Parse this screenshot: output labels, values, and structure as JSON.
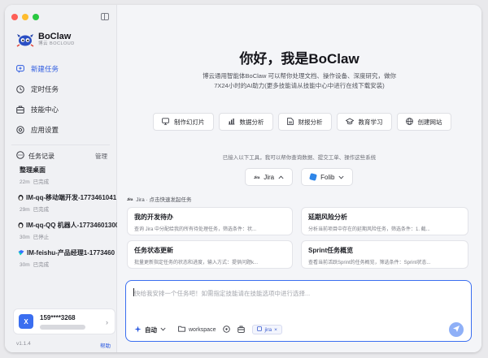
{
  "sidebar": {
    "brand": {
      "name": "BoClaw",
      "subtitle": "博云 BOCLOUD"
    },
    "nav": [
      {
        "label": "新建任务",
        "icon": "chat-plus-icon",
        "active": true
      },
      {
        "label": "定时任务",
        "icon": "clock-icon",
        "active": false
      },
      {
        "label": "技能中心",
        "icon": "skills-icon",
        "active": false
      },
      {
        "label": "应用设置",
        "icon": "gear-icon",
        "active": false
      }
    ],
    "history_title": "任务记录",
    "manage_label": "管理",
    "history": [
      {
        "title": "整理桌面",
        "time": "22m",
        "status": "已完成",
        "icon": ""
      },
      {
        "title": "IM-qq-移动端开发-1773461041",
        "time": "29m",
        "status": "已完成",
        "icon": "penguin-icon"
      },
      {
        "title": "IM-qq-QQ 机器人-17734601300",
        "time": "30m",
        "status": "已停止",
        "icon": "penguin-icon"
      },
      {
        "title": "IM-feishu-产品经理1-1773460",
        "time": "30m",
        "status": "已完成",
        "icon": "feishu-icon"
      }
    ],
    "user": {
      "phone": "159****3268",
      "avatar_letter": "X"
    },
    "version": "v1.1.4",
    "help_label": "帮助"
  },
  "main": {
    "greeting": "你好，我是BoClaw",
    "intro_line1": "博云通用智能体BoClaw 可以帮你处理文档、操作设备、深度研究，做你",
    "intro_line2": "7X24小时的AI助力(更多技能请从技能中心中进行在线下载安装)",
    "quick_actions": [
      {
        "label": "制作幻灯片",
        "icon": "slides-icon"
      },
      {
        "label": "数据分析",
        "icon": "chart-icon"
      },
      {
        "label": "财报分析",
        "icon": "document-icon"
      },
      {
        "label": "教育学习",
        "icon": "graduation-cap-icon"
      },
      {
        "label": "创建网站",
        "icon": "globe-icon"
      }
    ],
    "tools_hint": "已接入以下工具，我可以帮你查询数据、提交工单、操作这些系统",
    "tools": [
      {
        "label": "Jira",
        "expanded": true
      },
      {
        "label": "Folib",
        "expanded": false
      }
    ],
    "quick_start_label": "Jira · 点击快速发起任务",
    "cards": [
      {
        "title": "我的开发待办",
        "desc": "查询 Jira 中分配给我的所有待处理任务，筛选条件：状..."
      },
      {
        "title": "延期风险分析",
        "desc": "分析当前项目中存在的延期风险任务，筛选条件：1. 截..."
      },
      {
        "title": "任务状态更新",
        "desc": "批量更新指定任务的状态和进度，输入方式：提供问题k..."
      },
      {
        "title": "Sprint任务概览",
        "desc": "查看当前活跃Sprint的任务概览，筛选条件：Sprint状态..."
      }
    ],
    "composer": {
      "placeholder": "快给我安排一个任务吧！如需指定技能请在技能选项中进行选择...",
      "mode_label": "自动",
      "workspace_label": "workspace",
      "jira_chip": "jira"
    }
  },
  "colors": {
    "accent": "#2c5ae0",
    "send_disabled": "#8fb0f7"
  }
}
